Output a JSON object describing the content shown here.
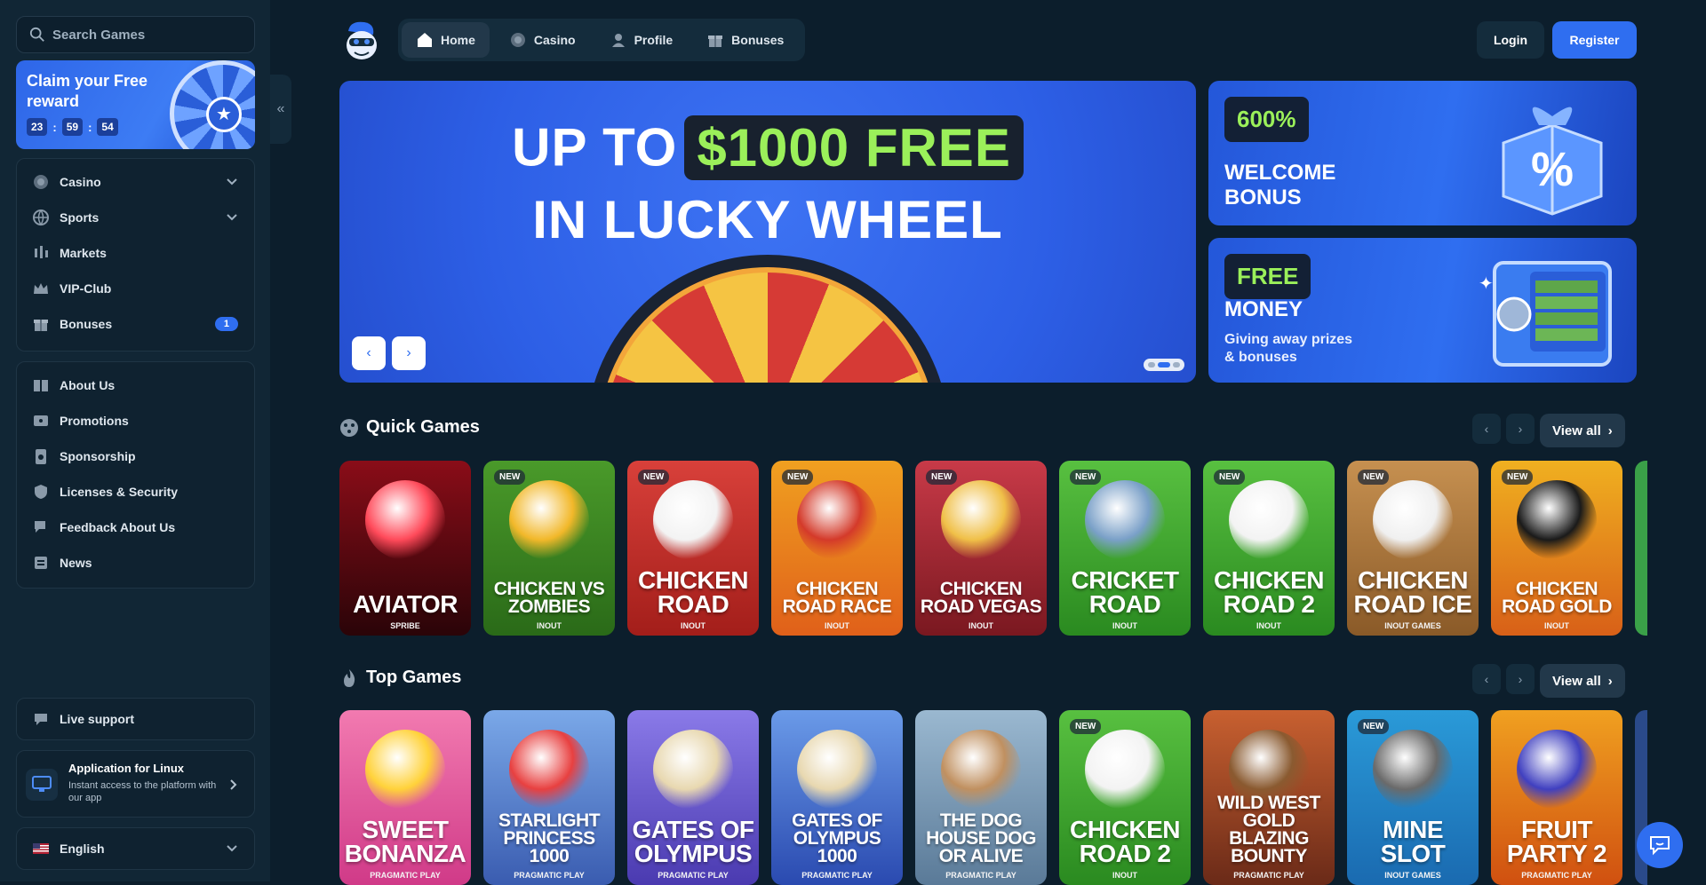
{
  "search": {
    "placeholder": "Search Games"
  },
  "reward": {
    "title": "Claim your Free reward",
    "timer": [
      "23",
      "59",
      "54"
    ],
    "sep": ":"
  },
  "sidebar": {
    "main": [
      {
        "label": "Casino"
      },
      {
        "label": "Sports"
      },
      {
        "label": "Markets"
      },
      {
        "label": "VIP-Club"
      },
      {
        "label": "Bonuses",
        "badge": "1"
      }
    ],
    "info": [
      {
        "label": "About Us"
      },
      {
        "label": "Promotions"
      },
      {
        "label": "Sponsorship"
      },
      {
        "label": "Licenses & Security"
      },
      {
        "label": "Feedback About Us"
      },
      {
        "label": "News"
      }
    ],
    "support": "Live support",
    "app": {
      "title": "Application for Linux",
      "desc": "Instant access to the platform with our app"
    },
    "language": "English"
  },
  "topnav": {
    "tabs": [
      {
        "label": "Home"
      },
      {
        "label": "Casino"
      },
      {
        "label": "Profile"
      },
      {
        "label": "Bonuses"
      }
    ],
    "login": "Login",
    "register": "Register"
  },
  "hero": {
    "line1a": "UP TO",
    "line1b": "$1000 FREE",
    "line2": "IN LUCKY WHEEL",
    "prev": "‹",
    "next": "›"
  },
  "promos": [
    {
      "tag": "600%",
      "head": "WELCOME BONUS"
    },
    {
      "tag": "FREE",
      "head": "MONEY",
      "sub": "Giving away prizes & bonuses"
    }
  ],
  "sections": {
    "quick": {
      "title": "Quick Games",
      "view_all": "View all",
      "games": [
        {
          "title": "AVIATOR",
          "provider": "SPRIBE",
          "new": ""
        },
        {
          "title": "CHICKEN VS ZOMBIES",
          "provider": "INOUT",
          "new": "NEW"
        },
        {
          "title": "CHICKEN ROAD",
          "provider": "INOUT",
          "new": "NEW"
        },
        {
          "title": "CHICKEN ROAD RACE",
          "provider": "INOUT",
          "new": "NEW"
        },
        {
          "title": "CHICKEN ROAD VEGAS",
          "provider": "INOUT",
          "new": "NEW"
        },
        {
          "title": "CRICKET ROAD",
          "provider": "INOUT",
          "new": "NEW"
        },
        {
          "title": "CHICKEN ROAD 2",
          "provider": "INOUT",
          "new": "NEW"
        },
        {
          "title": "CHICKEN ROAD ICE",
          "provider": "INOUT GAMES",
          "new": "NEW"
        },
        {
          "title": "CHICKEN ROAD GOLD",
          "provider": "INOUT",
          "new": "NEW"
        }
      ]
    },
    "top": {
      "title": "Top Games",
      "view_all": "View all",
      "games": [
        {
          "title": "SWEET BONANZA",
          "provider": "PRAGMATIC PLAY",
          "new": ""
        },
        {
          "title": "STARLIGHT PRINCESS 1000",
          "provider": "PRAGMATIC PLAY",
          "new": ""
        },
        {
          "title": "GATES OF OLYMPUS",
          "provider": "PRAGMATIC PLAY",
          "new": ""
        },
        {
          "title": "GATES OF OLYMPUS 1000",
          "provider": "PRAGMATIC PLAY",
          "new": ""
        },
        {
          "title": "THE DOG HOUSE DOG OR ALIVE",
          "provider": "PRAGMATIC PLAY",
          "new": ""
        },
        {
          "title": "CHICKEN ROAD 2",
          "provider": "INOUT",
          "new": "NEW"
        },
        {
          "title": "WILD WEST GOLD BLAZING BOUNTY",
          "provider": "PRAGMATIC PLAY",
          "new": ""
        },
        {
          "title": "MINE SLOT",
          "provider": "INOUT GAMES",
          "new": "NEW"
        },
        {
          "title": "FRUIT PARTY 2",
          "provider": "PRAGMATIC PLAY",
          "new": ""
        }
      ]
    }
  },
  "colors": {
    "accent": "#2f6ef0",
    "highlight": "#9bf05a",
    "bg": "#0c1e2c",
    "sidebar": "#112635"
  }
}
